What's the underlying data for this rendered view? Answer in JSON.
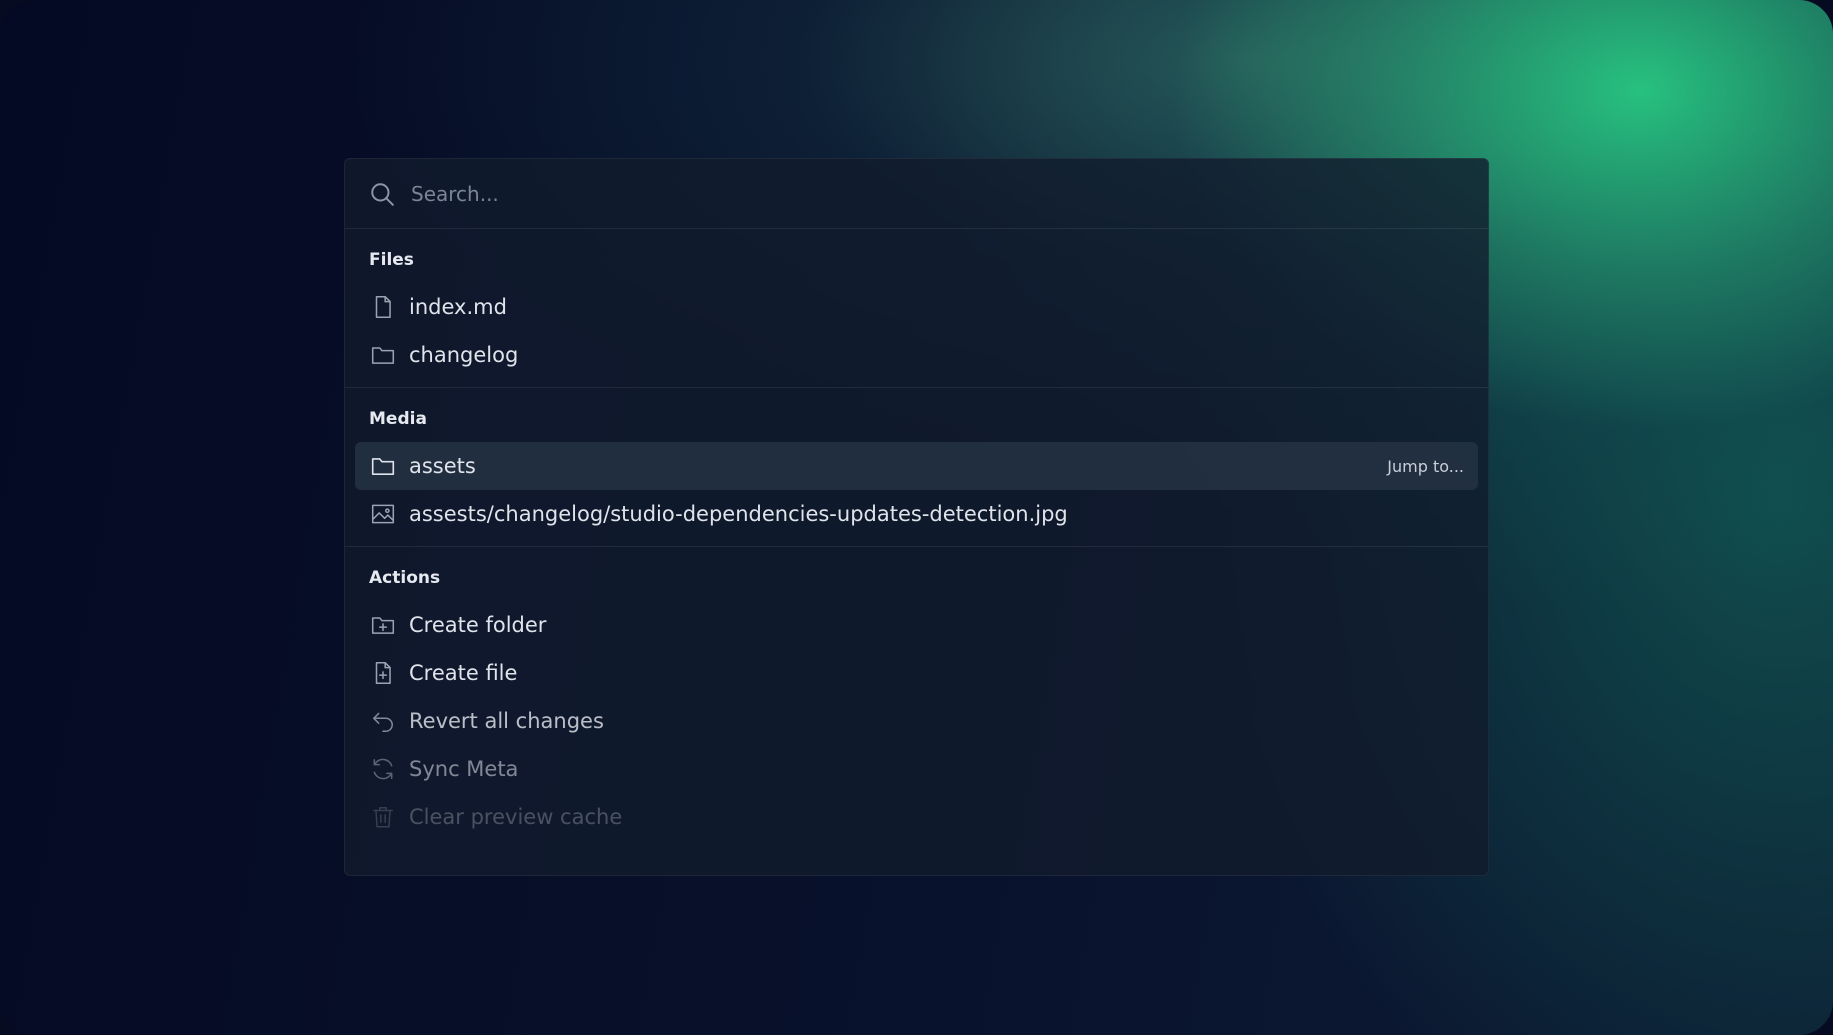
{
  "search": {
    "placeholder": "Search..."
  },
  "sections": {
    "files": {
      "title": "Files",
      "items": [
        {
          "label": "index.md",
          "icon": "file-icon"
        },
        {
          "label": "changelog",
          "icon": "folder-icon"
        }
      ]
    },
    "media": {
      "title": "Media",
      "items": [
        {
          "label": "assets",
          "icon": "folder-icon",
          "hint": "Jump to..."
        },
        {
          "label": "assests/changelog/studio-dependencies-updates-detection.jpg",
          "icon": "image-icon"
        }
      ]
    },
    "actions": {
      "title": "Actions",
      "items": [
        {
          "label": "Create folder",
          "icon": "folder-plus-icon"
        },
        {
          "label": "Create file",
          "icon": "file-plus-icon"
        },
        {
          "label": "Revert all changes",
          "icon": "undo-icon"
        },
        {
          "label": "Sync Meta",
          "icon": "refresh-icon"
        },
        {
          "label": "Clear preview cache",
          "icon": "trash-icon"
        }
      ]
    }
  },
  "colors": {
    "accent": "#1fc08a",
    "panel": "#111c2d",
    "text": "#dfe3ea",
    "muted": "#7c8596"
  }
}
